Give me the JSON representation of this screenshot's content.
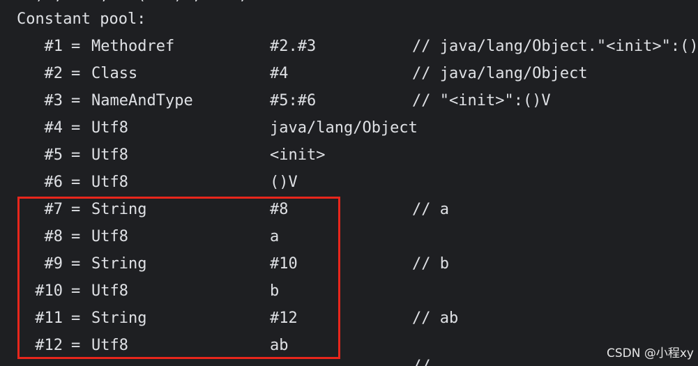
{
  "console": {
    "cut_top_text": "  ) ,    ,   (   ) ,    ,",
    "header": "Constant pool:",
    "rows": [
      {
        "index": "#1",
        "eq": "=",
        "type": "Methodref",
        "value": "#2.#3",
        "comment": "// java/lang/Object.\"<init>\":()"
      },
      {
        "index": "#2",
        "eq": "=",
        "type": "Class",
        "value": "#4",
        "comment": "// java/lang/Object"
      },
      {
        "index": "#3",
        "eq": "=",
        "type": "NameAndType",
        "value": "#5:#6",
        "comment": "// \"<init>\":()V"
      },
      {
        "index": "#4",
        "eq": "=",
        "type": "Utf8",
        "value": "java/lang/Object",
        "comment": ""
      },
      {
        "index": "#5",
        "eq": "=",
        "type": "Utf8",
        "value": "<init>",
        "comment": ""
      },
      {
        "index": "#6",
        "eq": "=",
        "type": "Utf8",
        "value": "()V",
        "comment": ""
      },
      {
        "index": "#7",
        "eq": "=",
        "type": "String",
        "value": "#8",
        "comment": "// a"
      },
      {
        "index": "#8",
        "eq": "=",
        "type": "Utf8",
        "value": "a",
        "comment": ""
      },
      {
        "index": "#9",
        "eq": "=",
        "type": "String",
        "value": "#10",
        "comment": "// b"
      },
      {
        "index": "#10",
        "eq": "=",
        "type": "Utf8",
        "value": "b",
        "comment": ""
      },
      {
        "index": "#11",
        "eq": "=",
        "type": "String",
        "value": "#12",
        "comment": "// ab"
      },
      {
        "index": "#12",
        "eq": "=",
        "type": "Utf8",
        "value": "ab",
        "comment": ""
      }
    ],
    "cut_bottom_text": "//"
  },
  "colors": {
    "background": "#1e1f22",
    "text": "#dfe1e5",
    "highlight_border": "#e8261c"
  },
  "watermark": "CSDN @小程xy"
}
